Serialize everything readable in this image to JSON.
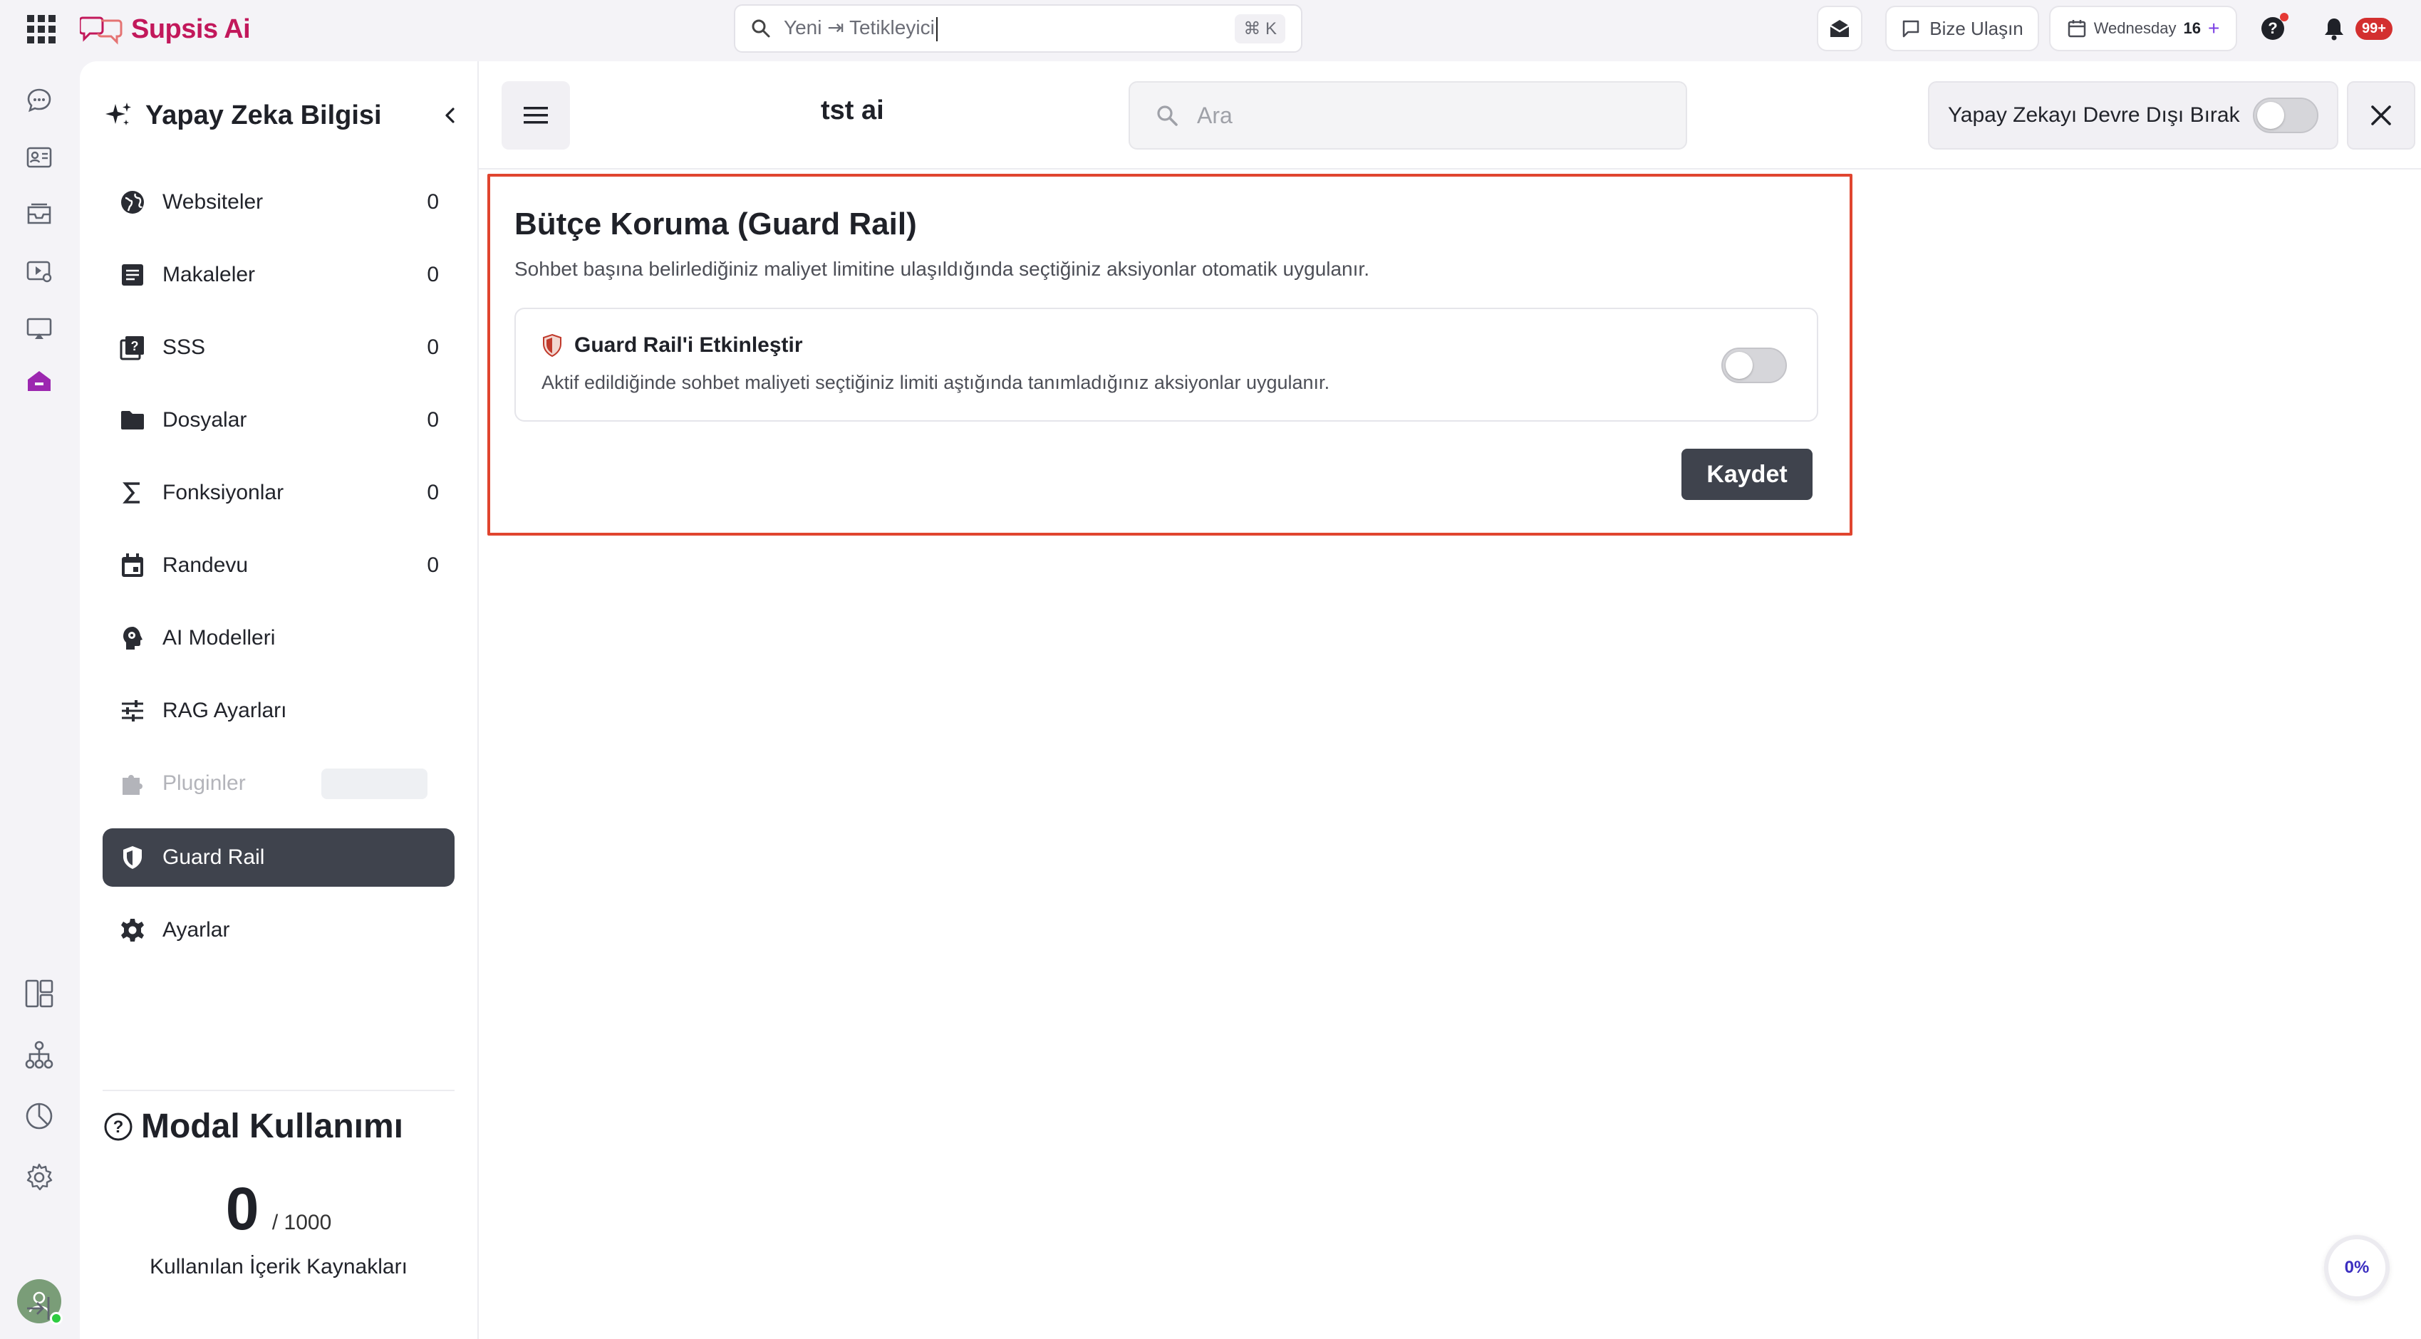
{
  "brand": {
    "name": "Supsis Ai"
  },
  "topbar": {
    "search_value": "Yeni ⇥ Tetikleyici",
    "search_shortcut": "⌘ K",
    "contact_label": "Bize Ulaşın",
    "date_day": "Wednesday",
    "date_num": "16",
    "notifications_badge": "99+"
  },
  "sidebar": {
    "title": "Yapay Zeka Bilgisi",
    "items": [
      {
        "label": "Websiteler",
        "count": "0",
        "icon": "globe-icon"
      },
      {
        "label": "Makaleler",
        "count": "0",
        "icon": "article-icon"
      },
      {
        "label": "SSS",
        "count": "0",
        "icon": "faq-icon"
      },
      {
        "label": "Dosyalar",
        "count": "0",
        "icon": "folder-icon"
      },
      {
        "label": "Fonksiyonlar",
        "count": "0",
        "icon": "sigma-icon"
      },
      {
        "label": "Randevu",
        "count": "0",
        "icon": "calendar-icon"
      },
      {
        "label": "AI Modelleri",
        "icon": "brain-icon"
      },
      {
        "label": "RAG Ayarları",
        "icon": "sliders-icon"
      },
      {
        "label": "Pluginler",
        "icon": "puzzle-icon",
        "disabled": true
      },
      {
        "label": "Guard Rail",
        "icon": "shield-icon",
        "active": true
      },
      {
        "label": "Ayarlar",
        "icon": "gear-icon"
      }
    ],
    "usage": {
      "title": "Modal Kullanımı",
      "used": "0",
      "total": "/ 1000",
      "caption": "Kullanılan İçerik Kaynakları"
    }
  },
  "main": {
    "chat_title": "tst ai",
    "search_placeholder": "Ara",
    "ai_toggle_label": "Yapay Zekayı Devre Dışı Bırak",
    "ai_toggle_on": false,
    "guard": {
      "title": "Bütçe Koruma (Guard Rail)",
      "description": "Sohbet başına belirlediğiniz maliyet limitine ulaşıldığında seçtiğiniz aksiyonlar otomatik uygulanır.",
      "card_title": "Guard Rail'i Etkinleştir",
      "card_description": "Aktif edildiğinde sohbet maliyeti seçtiğiniz limiti aştığında tanımladığınız aksiyonlar uygulanır.",
      "enabled": false,
      "save_label": "Kaydet"
    },
    "progress_label": "0%"
  },
  "colors": {
    "brand": "#c2185b",
    "active_nav": "#3f434d",
    "highlight_border": "#e0452f",
    "rail_active": "#9c27b0"
  }
}
